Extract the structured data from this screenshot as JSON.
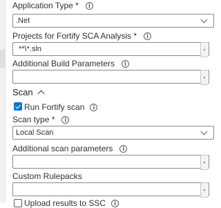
{
  "form": {
    "application_type": {
      "label": "Application Type *",
      "value": ".Net"
    },
    "projects": {
      "label": "Projects for Fortify SCA Analysis *",
      "value": "**\\*.sln"
    },
    "additional_build_parameters": {
      "label": "Additional Build Parameters",
      "value": ""
    },
    "scan_section": {
      "title": "Scan",
      "run_fortify_scan": {
        "label": "Run Fortify scan",
        "checked": true
      },
      "scan_type": {
        "label": "Scan type *",
        "value": "Local Scan"
      },
      "additional_scan_parameters": {
        "label": "Additional scan parameters",
        "value": ""
      },
      "custom_rulepacks": {
        "label": "Custom Rulepacks",
        "value": ""
      },
      "upload_results": {
        "label": "Upload results to SSC",
        "checked": false
      }
    }
  },
  "icons": {
    "info": "info-icon",
    "chevron_down": "chevron-down-icon",
    "chevron_up": "chevron-up-icon",
    "checkmark": "checkmark-icon",
    "more": "more-options-icon"
  },
  "colors": {
    "accent": "#0078d4",
    "border": "#8a8886",
    "text": "#323130"
  }
}
